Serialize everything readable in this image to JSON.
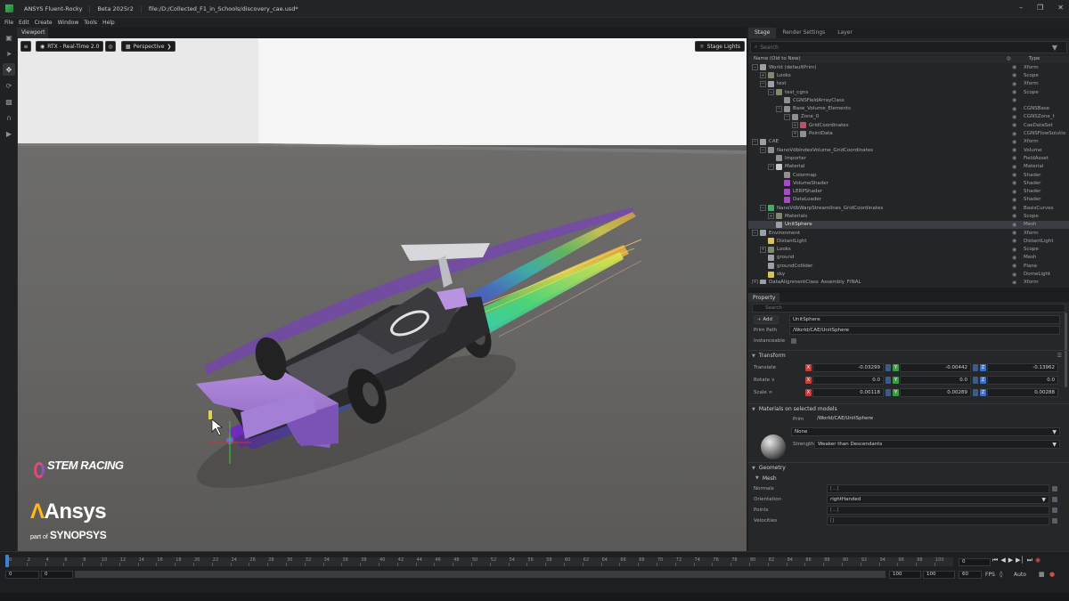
{
  "titlebar": {
    "app": "ANSYS Fluent-Rocky",
    "version": "Beta 2025r2",
    "file": "file:/D:/Collected_F1_in_Schools/discovery_cae.usd*"
  },
  "menubar": [
    "File",
    "Edit",
    "Create",
    "Window",
    "Tools",
    "Help"
  ],
  "viewport": {
    "tab": "Viewport",
    "renderer": "RTX - Real-Time 2.0",
    "camera": "Perspective",
    "lights": "Stage Lights"
  },
  "branding": {
    "stem": "STEM RACING",
    "ansys": "Ansys",
    "part_of": "part of",
    "synopsys": "SYNOPSYS"
  },
  "stage": {
    "tabs": [
      "Stage",
      "Render Settings",
      "Layer"
    ],
    "search_placeholder": "Search",
    "col_name": "Name (Old to New)",
    "col_type": "Type",
    "rows": [
      {
        "name": "World (defaultPrim)",
        "type": "Xform",
        "depth": 0,
        "exp": "−",
        "icon": "#9aa0a6",
        "sel": false
      },
      {
        "name": "Looks",
        "type": "Scope",
        "depth": 1,
        "exp": "+",
        "icon": "#7e8a6a",
        "sel": false
      },
      {
        "name": "test",
        "type": "Xform",
        "depth": 1,
        "exp": "−",
        "icon": "#9aa0a6",
        "sel": false
      },
      {
        "name": "test_cgns",
        "type": "Scope",
        "depth": 2,
        "exp": "−",
        "icon": "#7e8a6a",
        "sel": false
      },
      {
        "name": "CGNSFieldArrayClass",
        "type": "",
        "depth": 3,
        "exp": "",
        "icon": "#8d8f92",
        "sel": false
      },
      {
        "name": "Base_Volume_Elements",
        "type": "CGNSBase",
        "depth": 3,
        "exp": "−",
        "icon": "#8d8f92",
        "sel": false
      },
      {
        "name": "Zone_0",
        "type": "CGNSZone_t",
        "depth": 4,
        "exp": "−",
        "icon": "#8d8f92",
        "sel": false
      },
      {
        "name": "GridCoordinates",
        "type": "CaeDataSet",
        "depth": 5,
        "exp": "+",
        "icon": "#b3566c",
        "sel": false
      },
      {
        "name": "PointData",
        "type": "CGNSFlowSolutio",
        "depth": 5,
        "exp": "+",
        "icon": "#8d8f92",
        "sel": false
      },
      {
        "name": "CAE",
        "type": "Xform",
        "depth": 0,
        "exp": "−",
        "icon": "#9aa0a6",
        "sel": false
      },
      {
        "name": "NanoVdbIndexVolume_GridCoordinates",
        "type": "Volume",
        "depth": 1,
        "exp": "−",
        "icon": "#8d8f92",
        "sel": false
      },
      {
        "name": "Importer",
        "type": "FieldAsset",
        "depth": 2,
        "exp": "",
        "icon": "#8d8f92",
        "sel": false
      },
      {
        "name": "Material",
        "type": "Material",
        "depth": 2,
        "exp": "−",
        "icon": "#c9c9c9",
        "sel": false
      },
      {
        "name": "Colormap",
        "type": "Shader",
        "depth": 3,
        "exp": "",
        "icon": "#8d8f92",
        "sel": false
      },
      {
        "name": "VolumeShader",
        "type": "Shader",
        "depth": 3,
        "exp": "",
        "icon": "#a14fc0",
        "sel": false
      },
      {
        "name": "LERPShader",
        "type": "Shader",
        "depth": 3,
        "exp": "",
        "icon": "#a14fc0",
        "sel": false
      },
      {
        "name": "DataLoader",
        "type": "Shader",
        "depth": 3,
        "exp": "",
        "icon": "#a14fc0",
        "sel": false
      },
      {
        "name": "NanoVdbWarpStreamlines_GridCoordinates",
        "type": "BasisCurves",
        "depth": 1,
        "exp": "−",
        "icon": "#4fa86a",
        "sel": false
      },
      {
        "name": "Materials",
        "type": "Scope",
        "depth": 2,
        "exp": "+",
        "icon": "#7e8a6a",
        "sel": false
      },
      {
        "name": "UnitSphere",
        "type": "Mesh",
        "depth": 2,
        "exp": "",
        "icon": "#9aa0a6",
        "sel": true
      },
      {
        "name": "Environment",
        "type": "Xform",
        "depth": 0,
        "exp": "−",
        "icon": "#9aa0a6",
        "sel": false
      },
      {
        "name": "DistantLight",
        "type": "DistantLight",
        "depth": 1,
        "exp": "",
        "icon": "#d8c25a",
        "sel": false
      },
      {
        "name": "Looks",
        "type": "Scope",
        "depth": 1,
        "exp": "+",
        "icon": "#7e8a6a",
        "sel": false
      },
      {
        "name": "ground",
        "type": "Mesh",
        "depth": 1,
        "exp": "",
        "icon": "#9aa0a6",
        "sel": false
      },
      {
        "name": "groundCollider",
        "type": "Plane",
        "depth": 1,
        "exp": "",
        "icon": "#9aa0a6",
        "sel": false
      },
      {
        "name": "sky",
        "type": "DomeLight",
        "depth": 1,
        "exp": "",
        "icon": "#d8c25a",
        "sel": false
      },
      {
        "name": "DataAlignmentClass_Assembly_FINAL",
        "type": "Xform",
        "depth": 0,
        "exp": "+",
        "icon": "#9aa0a6",
        "sel": false
      }
    ]
  },
  "property": {
    "tab": "Property",
    "search_placeholder": "Search",
    "add_label": "Add",
    "prim_name": "UnitSphere",
    "prim_path_label": "Prim Path",
    "prim_path": "/World/CAE/UnitSphere",
    "instanceable_label": "Instanceable",
    "transform_title": "Transform",
    "translate_label": "Translate",
    "translate": [
      "-0.03299",
      "-0.00442",
      "-0.13962"
    ],
    "rotate_label": "Rotate",
    "rotate_arrow": "∨",
    "rotate": [
      "0.0",
      "0.0",
      "0.0"
    ],
    "scale_label": "Scale",
    "scale": [
      "0.00118",
      "0.00289",
      "0.00288"
    ],
    "materials_title": "Materials on selected models",
    "mat_prim_label": "Prim",
    "mat_prim": "/World/CAE/UnitSphere",
    "mat_value": "None",
    "strength_label": "Strength",
    "strength": "Weaker than Descendants",
    "geometry_title": "Geometry",
    "mesh_title": "Mesh",
    "normals_label": "Normals",
    "normals": "[...]",
    "orientation_label": "Orientation",
    "orientation": "rightHanded",
    "points_label": "Points",
    "points": "[...]",
    "velocities_label": "Velocities",
    "velocities": "[]"
  },
  "timeline": {
    "ticks": [
      "0",
      "2",
      "4",
      "6",
      "8",
      "10",
      "12",
      "14",
      "16",
      "18",
      "20",
      "22",
      "24",
      "26",
      "28",
      "30",
      "32",
      "34",
      "36",
      "38",
      "40",
      "42",
      "44",
      "46",
      "48",
      "50",
      "52",
      "54",
      "56",
      "58",
      "60",
      "62",
      "64",
      "66",
      "68",
      "70",
      "72",
      "74",
      "76",
      "78",
      "80",
      "82",
      "84",
      "86",
      "88",
      "90",
      "92",
      "94",
      "96",
      "98",
      "100"
    ],
    "start": "0",
    "start_inner": "0",
    "end_inner": "100",
    "end": "100",
    "current": "0",
    "fps_value": "60",
    "fps_label": "FPS",
    "auto_label": "Auto"
  }
}
